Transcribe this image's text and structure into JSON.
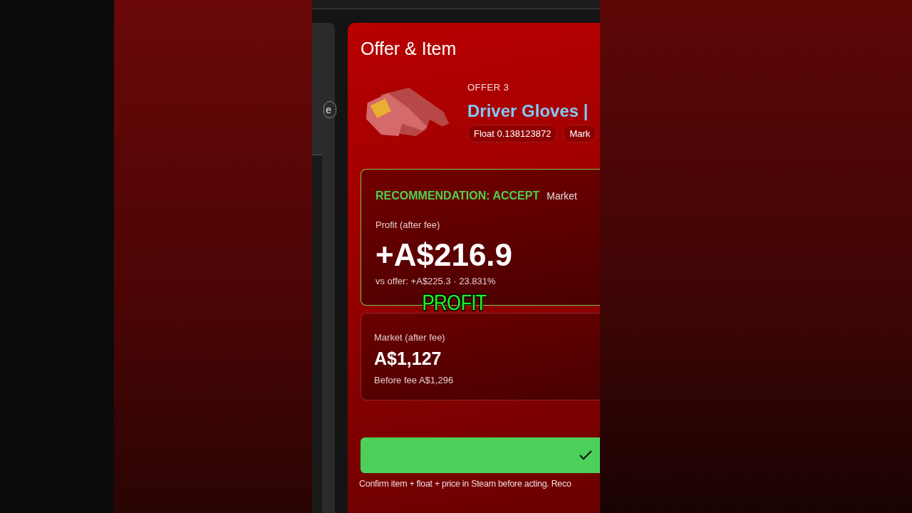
{
  "sidebar": {
    "chip": "e"
  },
  "card": {
    "title": "Offer & Item",
    "offer_label": "OFFER 3",
    "item_name": "Driver Gloves |",
    "chips": [
      "Float 0.138123872",
      "Mark"
    ]
  },
  "recommendation": {
    "label": "RECOMMENDATION: ACCEPT",
    "note": "Market",
    "profit_label": "Profit (after fee)",
    "profit": "+A$216.9",
    "vs_offer": "vs offer: +A$225.3 · 23.831%"
  },
  "market": {
    "label": "Market (after fee)",
    "value": "A$1,127",
    "before_fee": "Before fee A$1,296"
  },
  "footer_note": "Confirm item + float + price in Steam before acting. Reco",
  "caption": "PROFIT"
}
